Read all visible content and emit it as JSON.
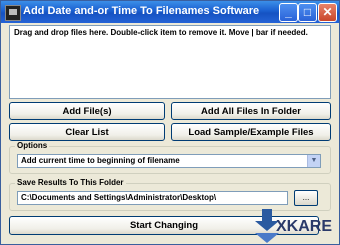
{
  "window": {
    "title": "Add Date and-or Time To Filenames Software",
    "min_symbol": "_",
    "max_symbol": "□",
    "close_symbol": "✕"
  },
  "dropzone": {
    "text": "Drag and drop files here. Double-click item to remove it. Move | bar if needed."
  },
  "buttons": {
    "add_files": "Add File(s)",
    "add_folder": "Add All Files In Folder",
    "clear_list": "Clear List",
    "load_sample": "Load Sample/Example Files",
    "start": "Start Changing",
    "browse": "..."
  },
  "options": {
    "label": "Options",
    "selected": "Add current time to beginning of filename",
    "arrow": "▼"
  },
  "save": {
    "label": "Save Results To This Folder",
    "path": "C:\\Documents and Settings\\Administrator\\Desktop\\"
  },
  "logo": {
    "text": "XKARE",
    "colors": {
      "primary": "#2a5aa0",
      "dark": "#2a3a6a"
    }
  }
}
